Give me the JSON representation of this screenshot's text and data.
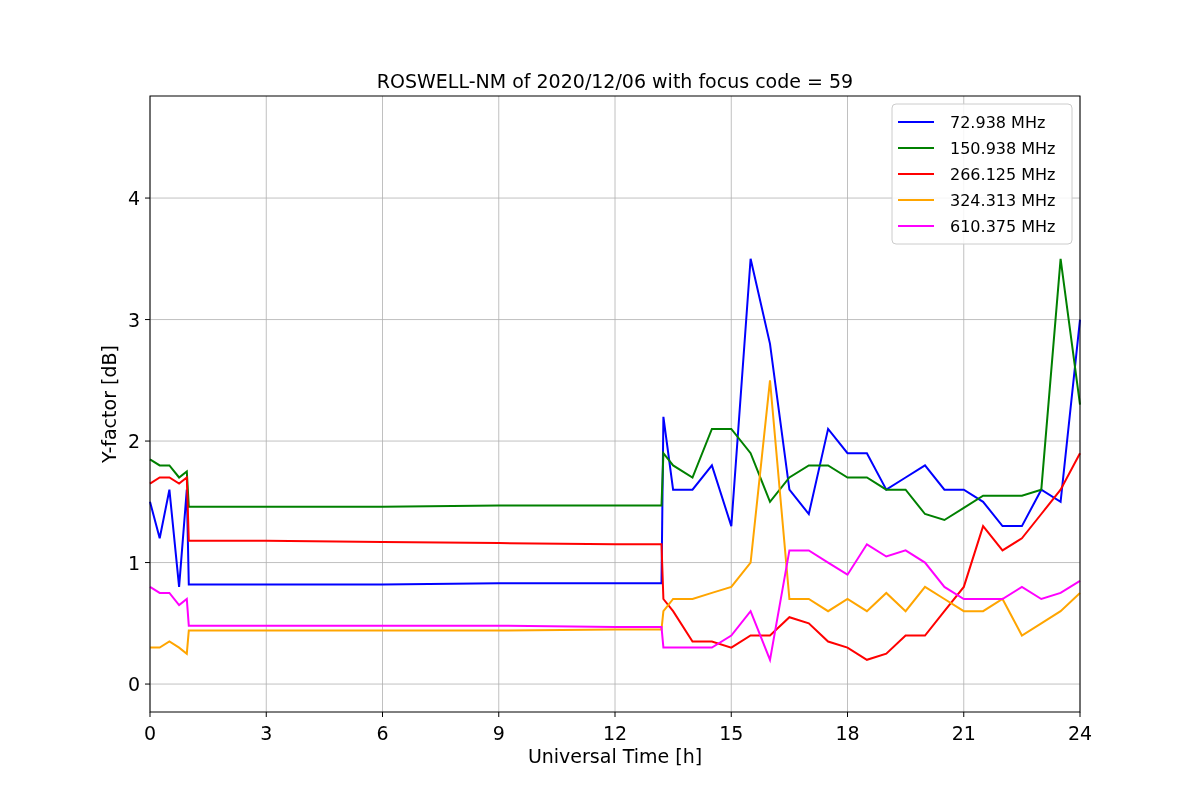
{
  "chart_data": {
    "type": "line",
    "title": "ROSWELL-NM of 2020/12/06 with focus code = 59",
    "xlabel": "Universal Time [h]",
    "ylabel": "Y-factor [dB]",
    "x": [
      0,
      0.25,
      0.5,
      0.75,
      0.95,
      1,
      3,
      6,
      9,
      12,
      13.2,
      13.25,
      13.5,
      14,
      14.5,
      15,
      15.5,
      16,
      16.5,
      17,
      17.5,
      18,
      18.5,
      19,
      19.5,
      20,
      20.5,
      21,
      21.5,
      22,
      22.5,
      23,
      23.5,
      24
    ],
    "series": [
      {
        "name": "72.938 MHz",
        "color": "#0000ff",
        "values": [
          1.5,
          1.2,
          1.6,
          0.8,
          1.6,
          0.82,
          0.82,
          0.82,
          0.83,
          0.83,
          0.83,
          2.2,
          1.6,
          1.6,
          1.8,
          1.3,
          3.5,
          2.8,
          1.6,
          1.4,
          2.1,
          1.9,
          1.9,
          1.6,
          1.7,
          1.8,
          1.6,
          1.6,
          1.5,
          1.3,
          1.3,
          1.6,
          1.5,
          3.0
        ]
      },
      {
        "name": "150.938 MHz",
        "color": "#008000",
        "values": [
          1.85,
          1.8,
          1.8,
          1.7,
          1.75,
          1.46,
          1.46,
          1.46,
          1.47,
          1.47,
          1.47,
          1.9,
          1.8,
          1.7,
          2.1,
          2.1,
          1.9,
          1.5,
          1.7,
          1.8,
          1.8,
          1.7,
          1.7,
          1.6,
          1.6,
          1.4,
          1.35,
          1.45,
          1.55,
          1.55,
          1.55,
          1.6,
          3.5,
          2.3
        ]
      },
      {
        "name": "266.125 MHz",
        "color": "#ff0000",
        "values": [
          1.65,
          1.7,
          1.7,
          1.65,
          1.7,
          1.18,
          1.18,
          1.17,
          1.16,
          1.15,
          1.15,
          0.7,
          0.6,
          0.35,
          0.35,
          0.3,
          0.4,
          0.4,
          0.55,
          0.5,
          0.35,
          0.3,
          0.2,
          0.25,
          0.4,
          0.4,
          0.6,
          0.8,
          1.3,
          1.1,
          1.2,
          1.4,
          1.6,
          1.9
        ]
      },
      {
        "name": "324.313 MHz",
        "color": "#ffa500",
        "values": [
          0.3,
          0.3,
          0.35,
          0.3,
          0.25,
          0.44,
          0.44,
          0.44,
          0.44,
          0.45,
          0.45,
          0.6,
          0.7,
          0.7,
          0.75,
          0.8,
          1.0,
          2.5,
          0.7,
          0.7,
          0.6,
          0.7,
          0.6,
          0.75,
          0.6,
          0.8,
          0.7,
          0.6,
          0.6,
          0.7,
          0.4,
          0.5,
          0.6,
          0.75
        ]
      },
      {
        "name": "610.375 MHz",
        "color": "#ff00ff",
        "values": [
          0.8,
          0.75,
          0.75,
          0.65,
          0.7,
          0.48,
          0.48,
          0.48,
          0.48,
          0.47,
          0.47,
          0.3,
          0.3,
          0.3,
          0.3,
          0.4,
          0.6,
          0.2,
          1.1,
          1.1,
          1.0,
          0.9,
          1.15,
          1.05,
          1.1,
          1.0,
          0.8,
          0.7,
          0.7,
          0.7,
          0.8,
          0.7,
          0.75,
          0.85
        ]
      }
    ],
    "grid": true,
    "legend": true,
    "xlim": [
      0,
      24
    ],
    "ylim": [
      -0.23,
      4.84
    ],
    "xticks": [
      0,
      3,
      6,
      9,
      12,
      15,
      18,
      21,
      24
    ],
    "yticks": [
      0,
      1,
      2,
      3,
      4
    ]
  }
}
